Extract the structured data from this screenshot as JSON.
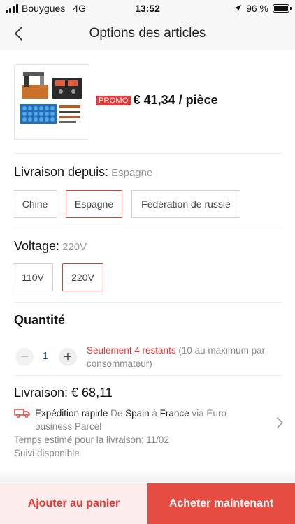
{
  "status": {
    "carrier": "Bouygues",
    "network": "4G",
    "time": "13:52",
    "battery": "96 %"
  },
  "nav": {
    "title": "Options des articles"
  },
  "product": {
    "promo_label": "PROMO",
    "price": "€ 41,34 / pièce"
  },
  "shipping_from": {
    "label": "Livraison depuis:",
    "selected": "Espagne",
    "options": [
      "Chine",
      "Espagne",
      "Fédération de russie"
    ]
  },
  "voltage": {
    "label": "Voltage:",
    "selected": "220V",
    "options": [
      "110V",
      "220V"
    ]
  },
  "quantity": {
    "label": "Quantité",
    "value": "1",
    "minus": "−",
    "plus": "+",
    "stock_highlight": "Seulement 4 restants",
    "stock_rest": " (10  au maximum par consommateur)"
  },
  "delivery": {
    "title": "Livraison: € 68,11",
    "method": "Expédition rapide",
    "de": " De ",
    "origin": "Spain",
    "a": " à ",
    "destination": "France",
    "via": " via Euro-business Parcel",
    "estimate": "Temps estimé pour la livraison: 11/02",
    "tracking": "Suivi disponible"
  },
  "actions": {
    "add_to_cart": "Ajouter au panier",
    "buy_now": "Acheter maintenant"
  },
  "colors": {
    "accent": "#e53935",
    "buy_button": "#e54d42",
    "cart_button_bg": "#fdecec"
  },
  "icons": [
    "back-icon",
    "truck-icon",
    "chevron-right-icon",
    "location-arrow-icon"
  ]
}
